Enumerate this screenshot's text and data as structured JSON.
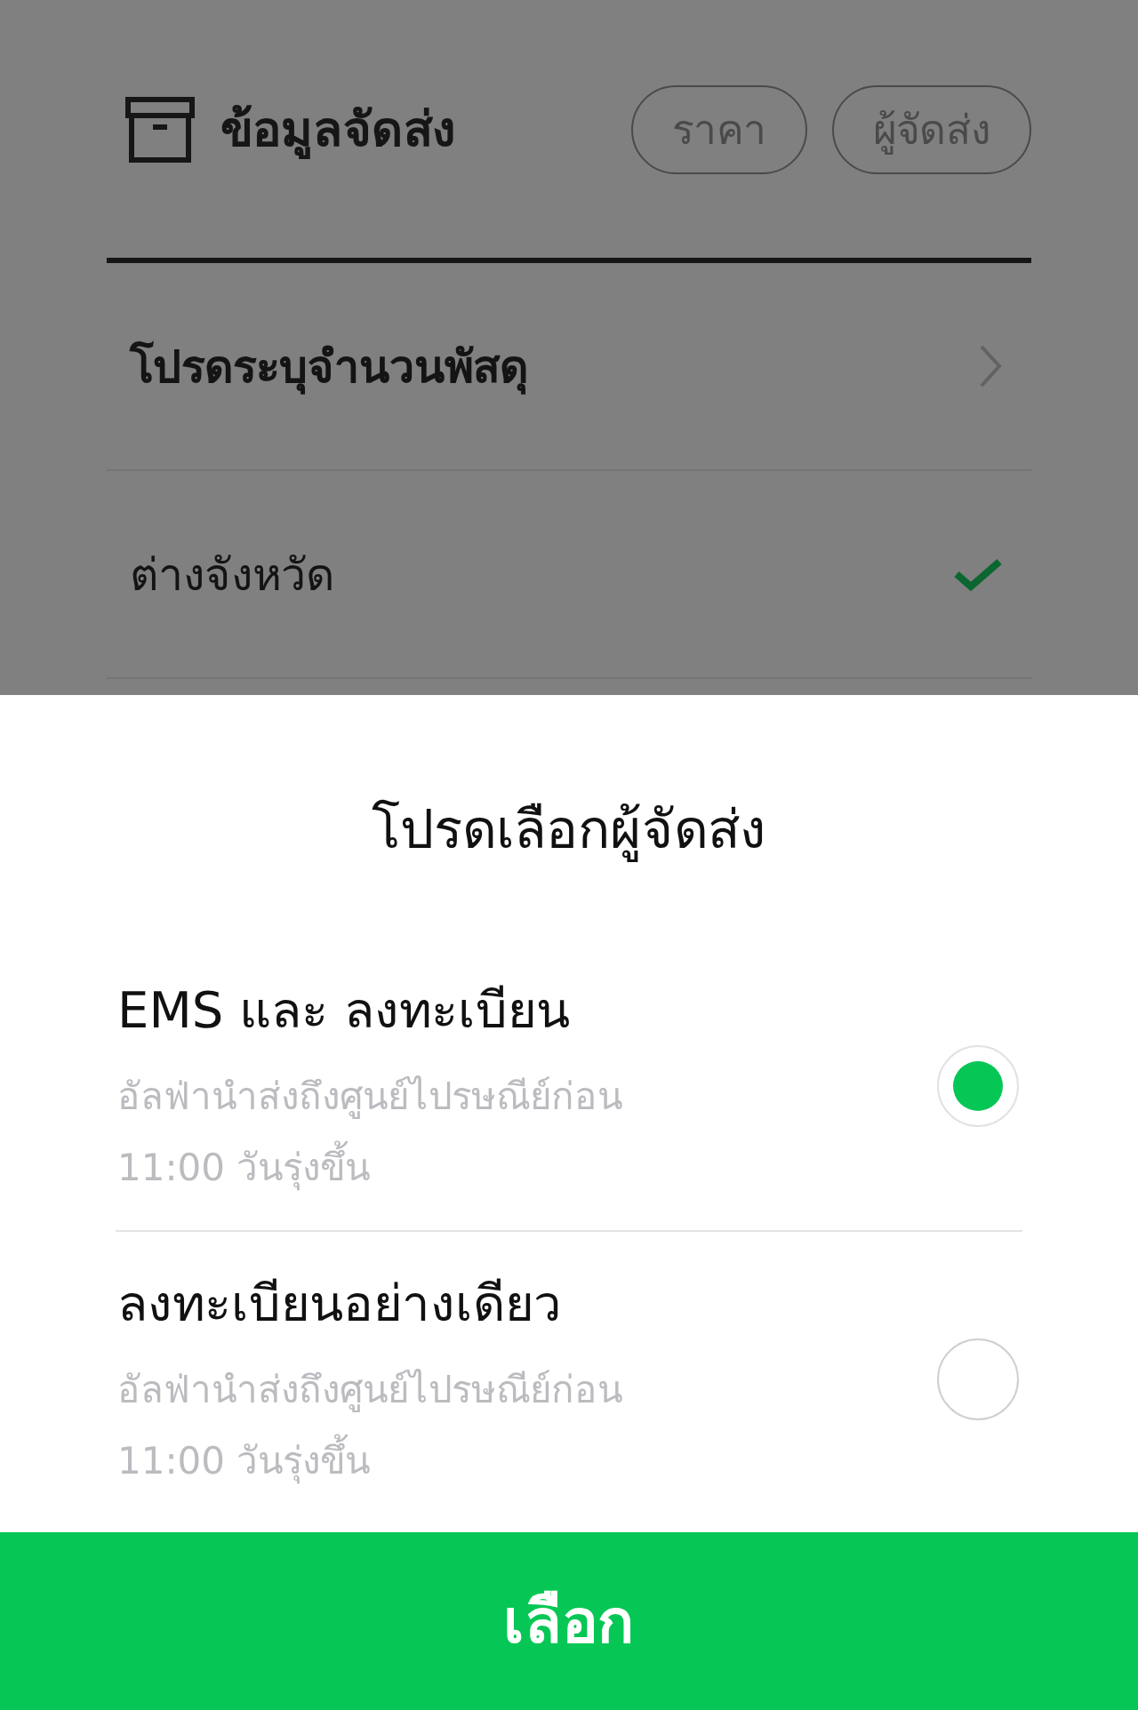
{
  "header": {
    "title": "ข้อมูลจัดส่ง",
    "chips": [
      "ราคา",
      "ผู้จัดส่ง"
    ]
  },
  "rows": [
    {
      "label": "โปรดระบุจำนวนพัสดุ",
      "kind": "link",
      "bold": true
    },
    {
      "label": "ต่างจังหวัด",
      "kind": "check",
      "bold": false
    }
  ],
  "sheet": {
    "title": "โปรดเลือกผู้จัดส่ง",
    "options": [
      {
        "name": "EMS และ ลงทะเบียน",
        "lines": [
          "อัลฟ่านำส่งถึงศูนย์ไปรษณีย์ก่อน",
          "11:00 วันรุ่งขึ้น"
        ],
        "selected": true
      },
      {
        "name": "ลงทะเบียนอย่างเดียว",
        "lines": [
          "อัลฟ่านำส่งถึงศูนย์ไปรษณีย์ก่อน",
          "11:00 วันรุ่งขึ้น"
        ],
        "selected": false
      }
    ],
    "button": "เลือก"
  }
}
